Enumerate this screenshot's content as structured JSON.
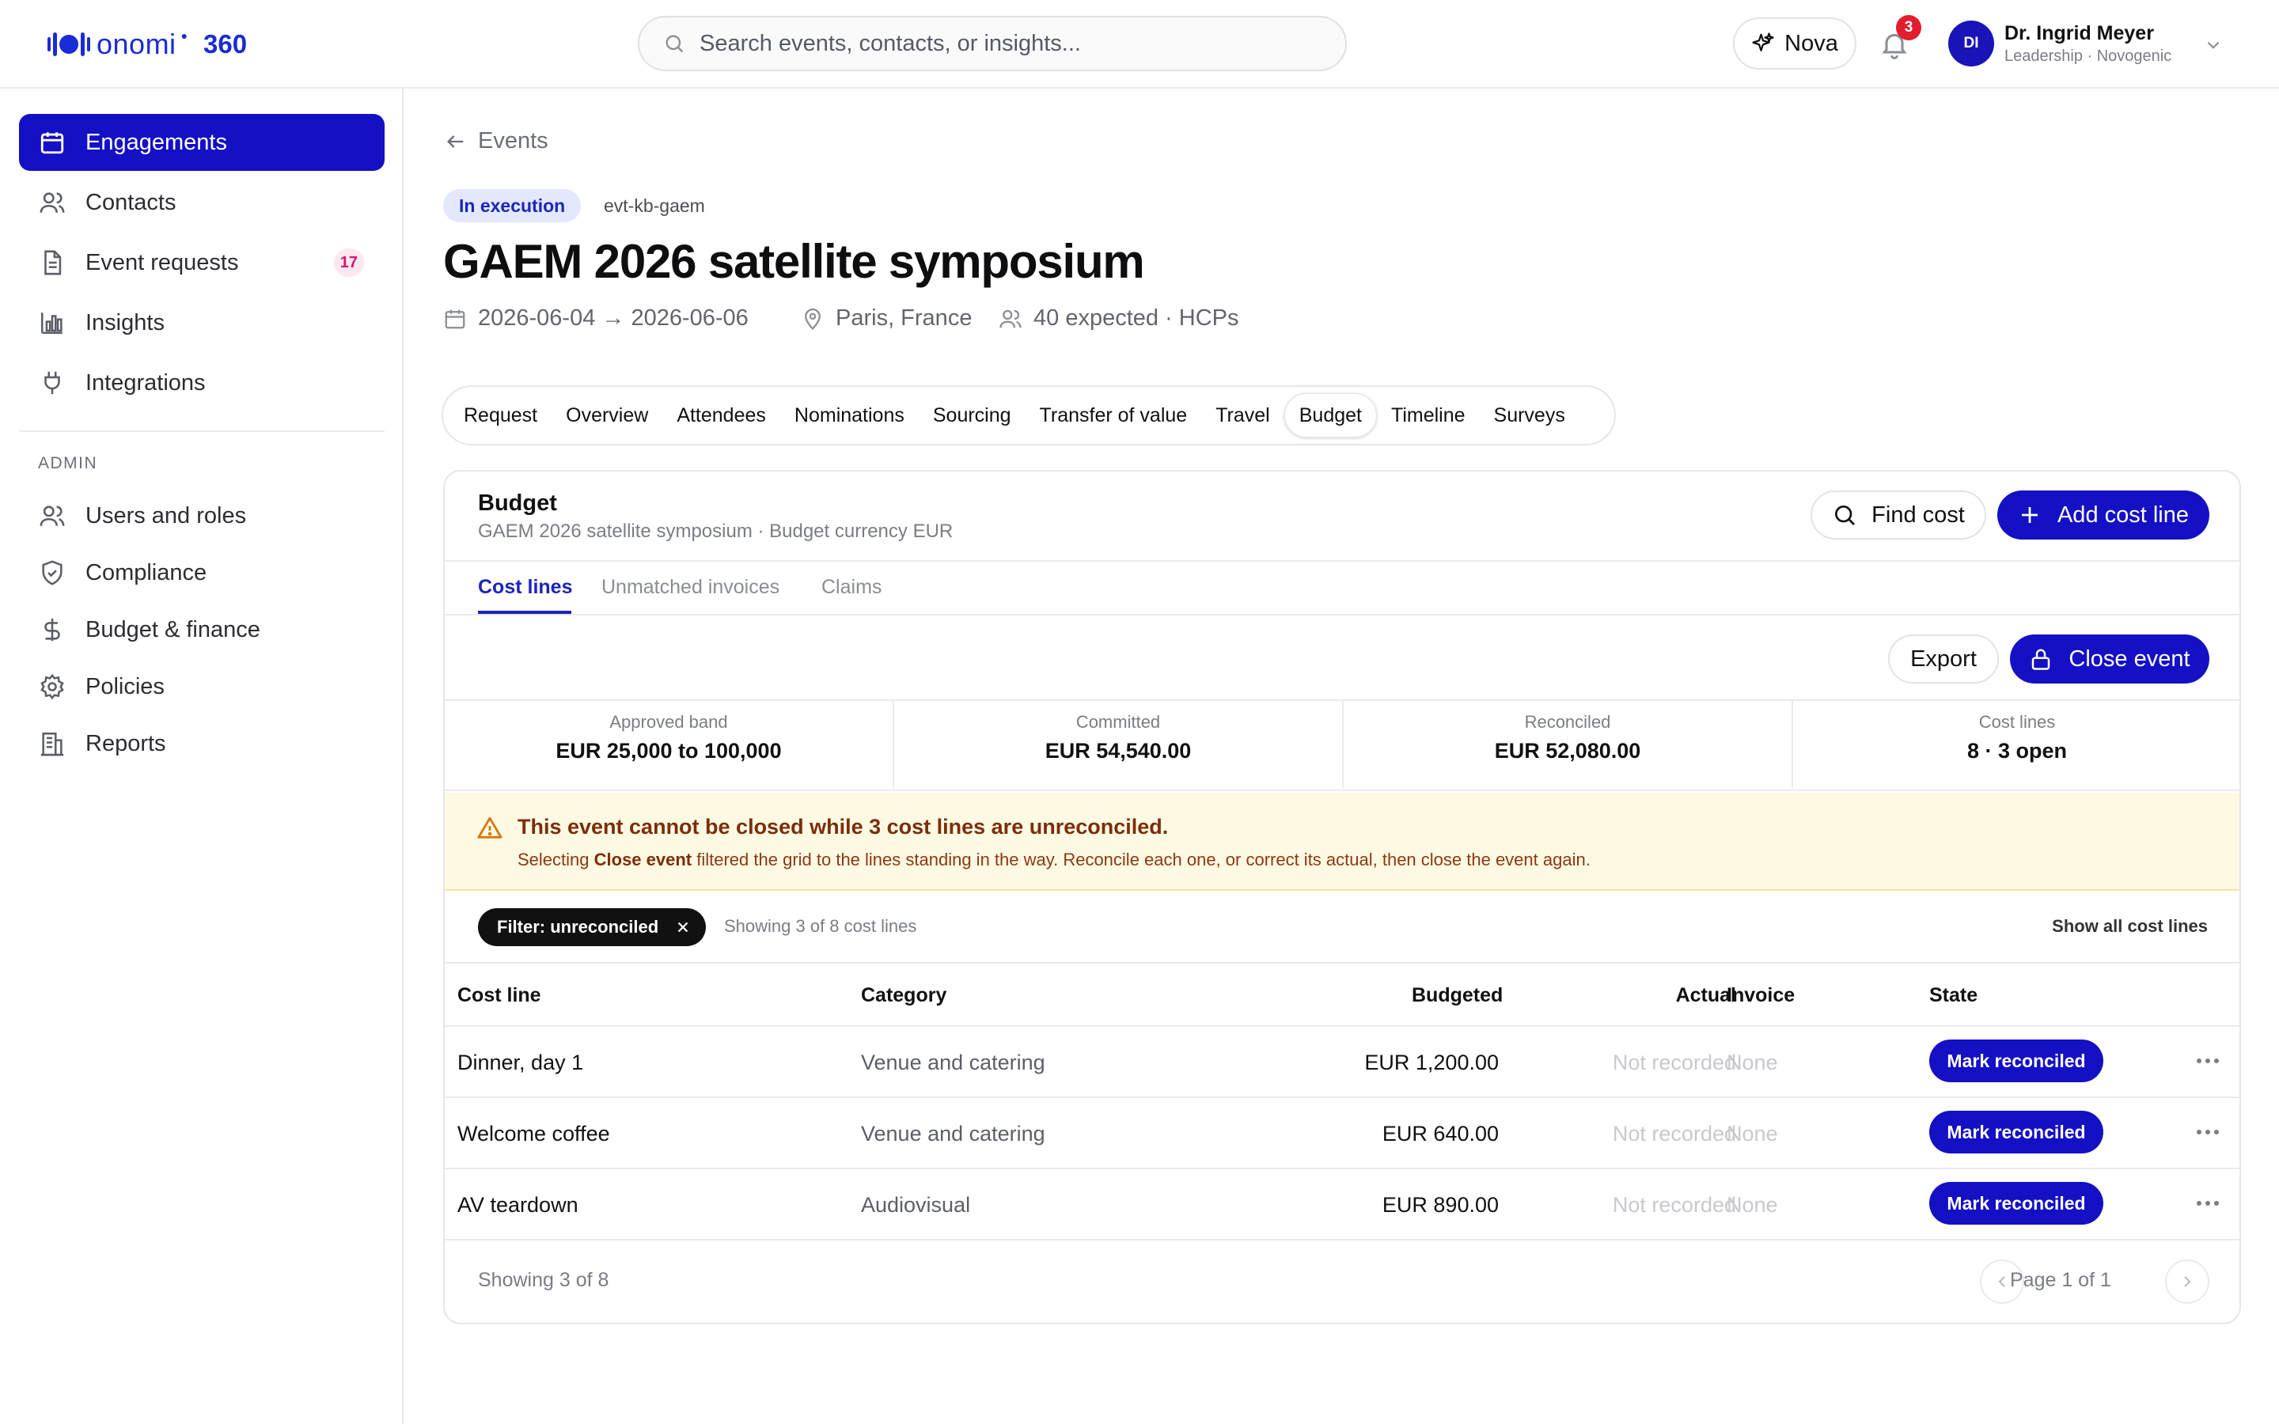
{
  "brand": {
    "word": "onomi",
    "suffix": "360",
    "accent": "#1a2cd6"
  },
  "search": {
    "placeholder": "Search events, contacts, or insights..."
  },
  "nova": {
    "label": "Nova",
    "icon": "sparkle-icon"
  },
  "notifications": {
    "count": "3",
    "icon": "bell-icon"
  },
  "user": {
    "initials": "DI",
    "name": "Dr. Ingrid Meyer",
    "subtitle": "Leadership · Novogenic"
  },
  "sidebar": {
    "items": [
      {
        "label": "Engagements",
        "icon": "calendar-icon",
        "active": true
      },
      {
        "label": "Contacts",
        "icon": "users-icon"
      },
      {
        "label": "Event requests",
        "icon": "document-icon",
        "count": "17"
      },
      {
        "label": "Insights",
        "icon": "bar-chart-icon"
      },
      {
        "label": "Integrations",
        "icon": "plug-icon"
      }
    ],
    "admin_heading": "ADMIN",
    "admin_items": [
      {
        "label": "Users and roles",
        "icon": "users-icon"
      },
      {
        "label": "Compliance",
        "icon": "shield-icon"
      },
      {
        "label": "Budget & finance",
        "icon": "dollar-icon"
      },
      {
        "label": "Policies",
        "icon": "gear-icon"
      },
      {
        "label": "Reports",
        "icon": "building-icon"
      }
    ]
  },
  "breadcrumb": {
    "back_label": "Events"
  },
  "event": {
    "status": "In execution",
    "id": "evt-kb-gaem",
    "title": "GAEM 2026 satellite symposium",
    "dates": "2026-06-04 → 2026-06-06",
    "location": "Paris, France",
    "attendance": "40 expected · HCPs"
  },
  "tabs": [
    "Request",
    "Overview",
    "Attendees",
    "Nominations",
    "Sourcing",
    "Transfer of value",
    "Travel",
    "Budget",
    "Timeline",
    "Surveys"
  ],
  "active_tab": "Budget",
  "budget": {
    "title": "Budget",
    "subtitle": "GAEM 2026 satellite symposium · Budget currency EUR",
    "find_label": "Find cost",
    "add_label": "Add cost line",
    "subtabs": [
      "Cost lines",
      "Unmatched invoices",
      "Claims"
    ],
    "export_label": "Export",
    "close_label": "Close event",
    "stats": [
      {
        "label": "Approved band",
        "value": "EUR 25,000 to 100,000"
      },
      {
        "label": "Committed",
        "value": "EUR 54,540.00"
      },
      {
        "label": "Reconciled",
        "value": "EUR 52,080.00"
      },
      {
        "label": "Cost lines",
        "value": "8 · 3 open"
      }
    ],
    "warning": {
      "title": "This event cannot be closed while 3 cost lines are unreconciled.",
      "text_pre": "Selecting ",
      "text_bold": "Close event",
      "text_post": " filtered the grid to the lines standing in the way. Reconcile each one, or correct its actual, then close the event again."
    },
    "filter": {
      "chip": "Filter: unreconciled",
      "count_text": "Showing 3 of 8 cost lines",
      "show_all": "Show all cost lines"
    },
    "table": {
      "headers": [
        "Cost line",
        "Category",
        "Budgeted",
        "Actual",
        "Invoice",
        "State"
      ],
      "rows": [
        {
          "name": "Dinner, day 1",
          "category": "Venue and catering",
          "budgeted": "EUR 1,200.00",
          "actual": "Not recorded",
          "invoice": "None",
          "action": "Mark reconciled"
        },
        {
          "name": "Welcome coffee",
          "category": "Venue and catering",
          "budgeted": "EUR 640.00",
          "actual": "Not recorded",
          "invoice": "None",
          "action": "Mark reconciled"
        },
        {
          "name": "AV teardown",
          "category": "Audiovisual",
          "budgeted": "EUR 890.00",
          "actual": "Not recorded",
          "invoice": "None",
          "action": "Mark reconciled"
        }
      ]
    },
    "footer": {
      "showing": "Showing 3 of 8",
      "page": "Page 1 of 1"
    }
  }
}
